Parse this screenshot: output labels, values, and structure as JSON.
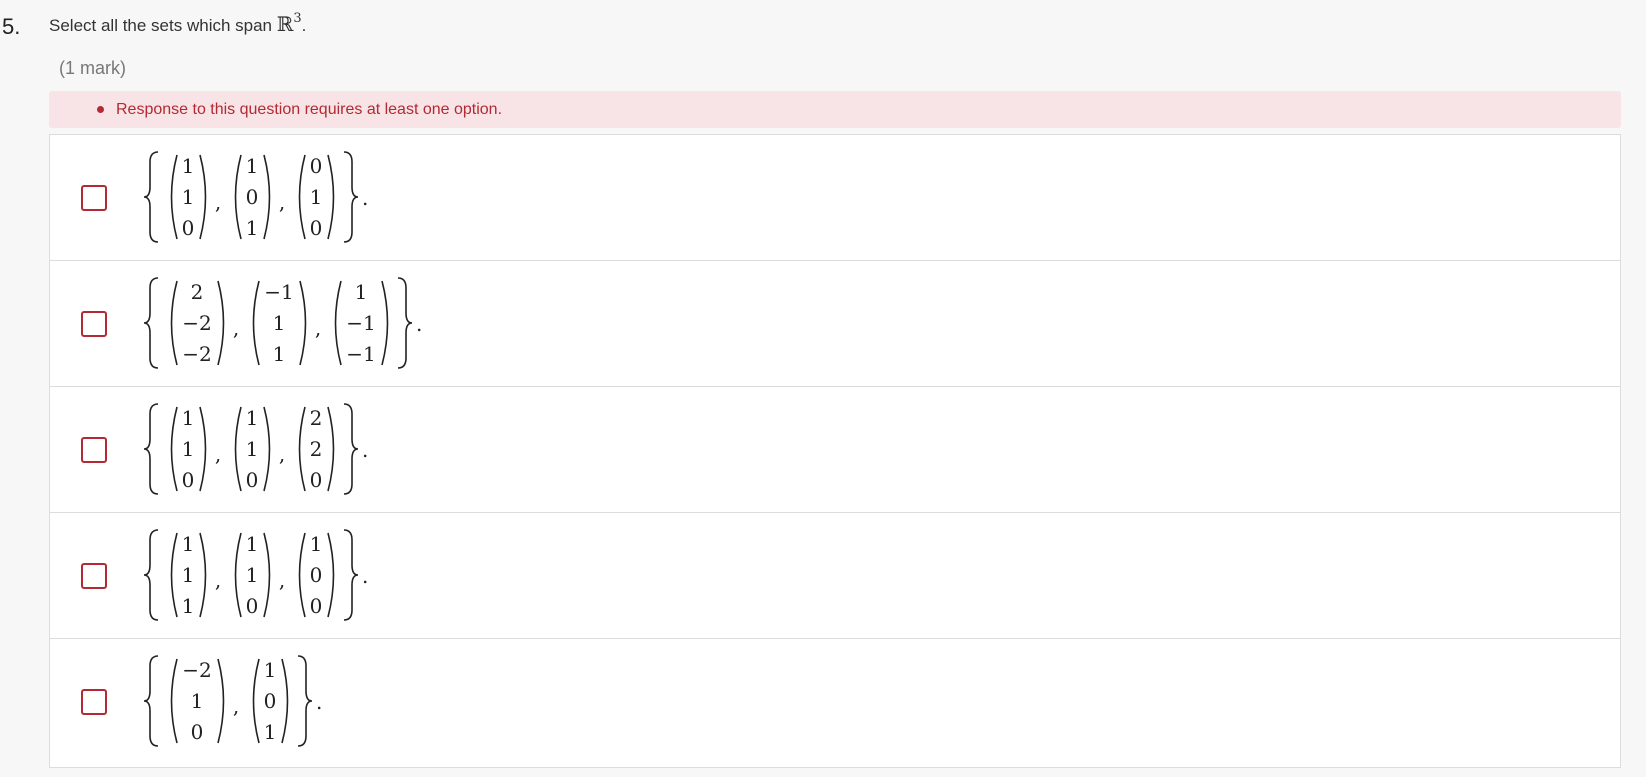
{
  "question": {
    "number": "5.",
    "prompt_prefix": "Select all the sets which span ",
    "prompt_math": "ℝ",
    "prompt_exponent": "3",
    "prompt_suffix": ".",
    "marks": "(1 mark)"
  },
  "validation": {
    "message": "Response to this question requires at least one option."
  },
  "options": [
    {
      "vectors": [
        [
          "1",
          "1",
          "0"
        ],
        [
          "1",
          "0",
          "1"
        ],
        [
          "0",
          "1",
          "0"
        ]
      ]
    },
    {
      "vectors": [
        [
          "2",
          "−2",
          "−2"
        ],
        [
          "−1",
          "1",
          "1"
        ],
        [
          "1",
          "−1",
          "−1"
        ]
      ]
    },
    {
      "vectors": [
        [
          "1",
          "1",
          "0"
        ],
        [
          "1",
          "1",
          "0"
        ],
        [
          "2",
          "2",
          "0"
        ]
      ]
    },
    {
      "vectors": [
        [
          "1",
          "1",
          "1"
        ],
        [
          "1",
          "1",
          "0"
        ],
        [
          "1",
          "0",
          "0"
        ]
      ]
    },
    {
      "vectors": [
        [
          "−2",
          "1",
          "0"
        ],
        [
          "1",
          "0",
          "1"
        ]
      ]
    }
  ]
}
